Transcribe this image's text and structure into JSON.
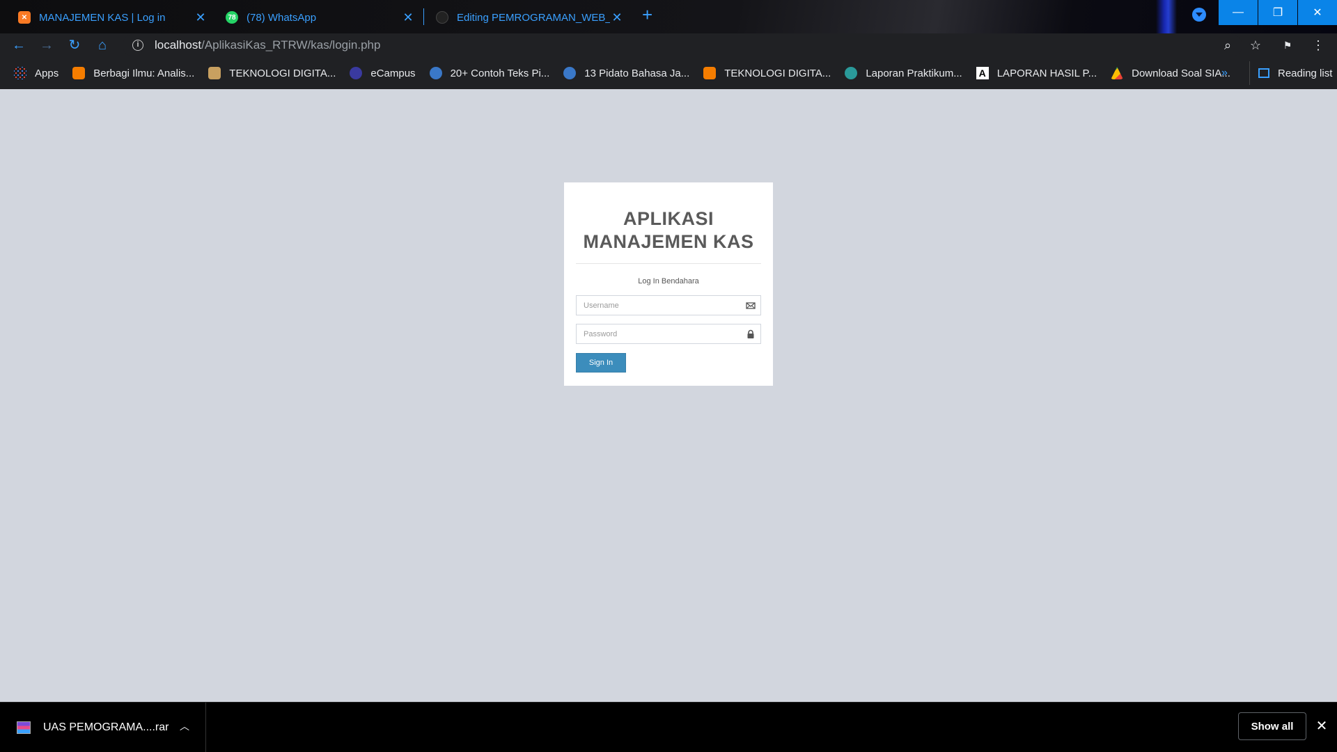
{
  "browser": {
    "tabs": [
      {
        "title": "MANAJEMEN KAS | Log in",
        "favicon": "xampp-icon",
        "active": true
      },
      {
        "title": "(78) WhatsApp",
        "favicon": "whatsapp-icon",
        "badge": "78"
      },
      {
        "title": "Editing PEMROGRAMAN_WEB_U",
        "favicon": "github-icon"
      }
    ],
    "url": {
      "host": "localhost",
      "path": "/AplikasiKas_RTRW/kas/login.php"
    },
    "bookmarks": [
      {
        "label": "Apps",
        "icon": "apps-grid-icon"
      },
      {
        "label": "Berbagi Ilmu: Analis...",
        "icon": "blogger-icon"
      },
      {
        "label": "TEKNOLOGI DIGITA...",
        "icon": "site-icon"
      },
      {
        "label": "eCampus",
        "icon": "ecampus-icon"
      },
      {
        "label": "20+ Contoh Teks Pi...",
        "icon": "globe-icon"
      },
      {
        "label": "13 Pidato Bahasa Ja...",
        "icon": "globe-icon"
      },
      {
        "label": "TEKNOLOGI DIGITA...",
        "icon": "blogger-icon"
      },
      {
        "label": "Laporan Praktikum...",
        "icon": "site-icon"
      },
      {
        "label": "LAPORAN HASIL P...",
        "icon": "letter-a-icon"
      },
      {
        "label": "Download Soal SIA...",
        "icon": "drive-icon"
      }
    ],
    "reading_list": "Reading list",
    "more_bookmarks": "»"
  },
  "login": {
    "title_line1": "APLIKASI",
    "title_line2": "MANAJEMEN KAS",
    "message": "Log In Bendahara",
    "username_placeholder": "Username",
    "password_placeholder": "Password",
    "signin_label": "Sign In"
  },
  "downloads": {
    "file_name": "UAS PEMOGRAMA....rar",
    "show_all": "Show all"
  },
  "colors": {
    "page_bg": "#d2d6de",
    "button": "#3c8dbc",
    "chrome_accent": "#3aa0ff",
    "title": "#5a5a5a"
  }
}
